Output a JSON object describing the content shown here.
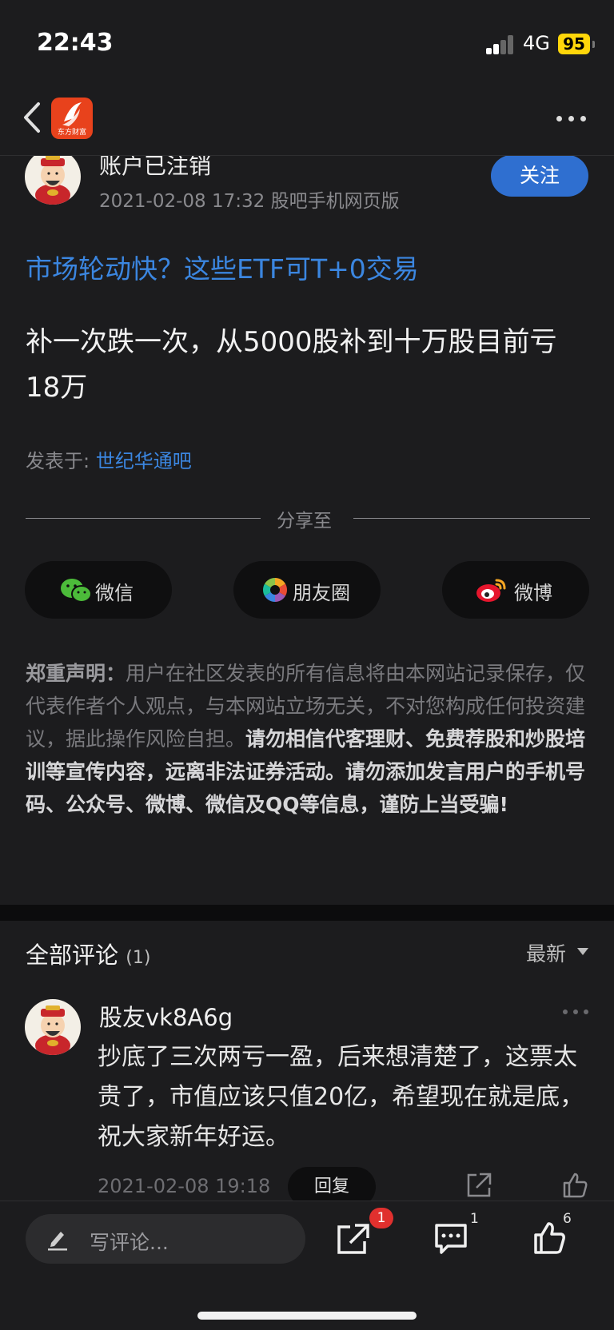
{
  "status_bar": {
    "time": "22:43",
    "network": "4G",
    "battery": "95"
  },
  "nav": {
    "logo_text": "东方财富"
  },
  "author": {
    "name": "账户已注销",
    "meta": "2021-02-08 17:32 股吧手机网页版",
    "follow_label": "关注"
  },
  "post": {
    "ad_link": "市场轮动快？这些ETF可T+0交易",
    "body": "补一次跌一次，从5000股补到十万股目前亏18万",
    "posted_in_label": "发表于: ",
    "bar_name": "世纪华通吧"
  },
  "share": {
    "label": "分享至",
    "wechat": "微信",
    "moments": "朋友圈",
    "weibo": "微博"
  },
  "disclaimer": {
    "title": "郑重声明：",
    "normal": "用户在社区发表的所有信息将由本网站记录保存，仅代表作者个人观点，与本网站立场无关，不对您构成任何投资建议，据此操作风险自担。",
    "warning": "请勿相信代客理财、免费荐股和炒股培训等宣传内容，远离非法证券活动。请勿添加发言用户的手机号码、公众号、微博、微信及QQ等信息，谨防上当受骗!"
  },
  "comments": {
    "title": "全部评论",
    "count": "(1)",
    "sort": "最新",
    "items": [
      {
        "user": "股友vk8A6g",
        "text": "抄底了三次两亏一盈，后来想清楚了，这票太贵了，市值应该只值20亿，希望现在就是底，祝大家新年好运。",
        "time": "2021-02-08 19:18",
        "reply_label": "回复"
      }
    ]
  },
  "bottom_bar": {
    "write_placeholder": "写评论...",
    "share_badge": "1",
    "comment_count": "1",
    "like_count": "6"
  },
  "colors": {
    "accent": "#2f6fd0",
    "link": "#3b86e0",
    "badge": "#e0302e",
    "battery": "#ffd60a"
  }
}
